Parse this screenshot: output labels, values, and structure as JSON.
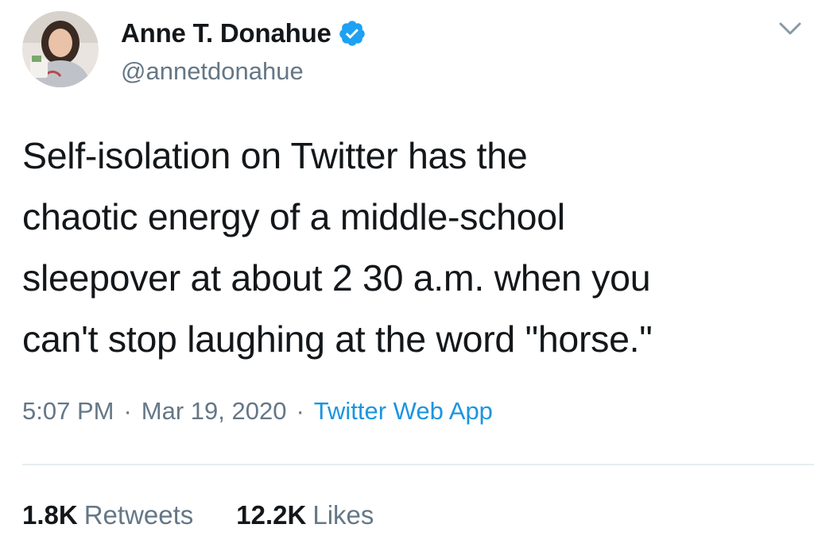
{
  "author": {
    "display_name": "Anne T. Donahue",
    "handle": "@annetdonahue",
    "verified": true
  },
  "tweet": {
    "text": "Self-isolation on Twitter has the\nchaotic energy of a middle-school\nsleepover at about 2 30 a.m. when you\ncan't stop laughing at the word \"horse.\"",
    "time": "5:07 PM",
    "separator": "·",
    "date": "Mar 19, 2020",
    "source": "Twitter Web App"
  },
  "stats": {
    "retweets_count": "1.8K",
    "retweets_label": "Retweets",
    "likes_count": "12.2K",
    "likes_label": "Likes"
  },
  "icons": {
    "verified": "verified-badge-icon",
    "caret": "chevron-down-icon"
  },
  "colors": {
    "text_primary": "#14171a",
    "text_secondary": "#657786",
    "link": "#1b95e0",
    "verified": "#1da1f2",
    "divider": "#e6ecf0"
  }
}
